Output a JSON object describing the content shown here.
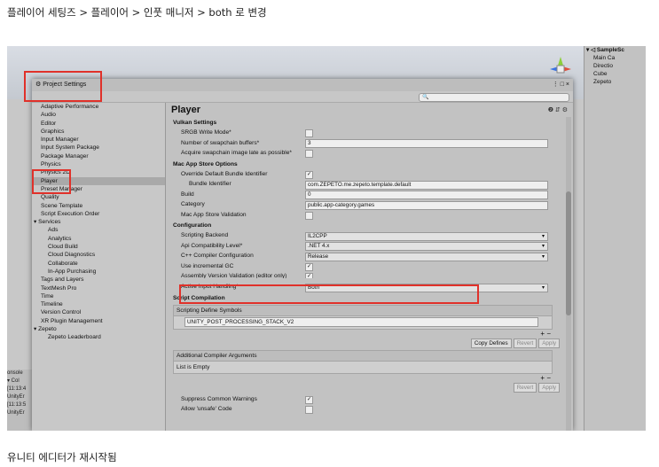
{
  "captions": {
    "top": "플레이어 세팅즈 > 플레이어 > 인풋 매니저 > both 로 변경",
    "bottom": "유니티 에디터가 재시작됨"
  },
  "hierarchy": {
    "items": [
      "▾ ◁ SampleSc",
      "Main Ca",
      "Directio",
      "Cube",
      "Zepeto"
    ]
  },
  "console": {
    "title": "onsole",
    "lines": [
      "▾ Col",
      "[11:13:4",
      "UnityEr",
      "[11:13:5",
      "UnityEr"
    ]
  },
  "window": {
    "title": "Project Settings",
    "controls": "⋮ □ ×",
    "search_placeholder": "🔍"
  },
  "sidebar": {
    "items": [
      {
        "label": "Adaptive Performance",
        "kind": "item"
      },
      {
        "label": "Audio",
        "kind": "item"
      },
      {
        "label": "Editor",
        "kind": "item"
      },
      {
        "label": "Graphics",
        "kind": "item"
      },
      {
        "label": "Input Manager",
        "kind": "item"
      },
      {
        "label": "Input System Package",
        "kind": "item"
      },
      {
        "label": "Package Manager",
        "kind": "item"
      },
      {
        "label": "Physics",
        "kind": "item"
      },
      {
        "label": "Physics 2D",
        "kind": "item"
      },
      {
        "label": "Player",
        "kind": "item",
        "selected": true
      },
      {
        "label": "Preset Manager",
        "kind": "item"
      },
      {
        "label": "Quality",
        "kind": "item"
      },
      {
        "label": "Scene Template",
        "kind": "item"
      },
      {
        "label": "Script Execution Order",
        "kind": "item"
      },
      {
        "label": "▾ Services",
        "kind": "group"
      },
      {
        "label": "Ads",
        "kind": "sub"
      },
      {
        "label": "Analytics",
        "kind": "sub"
      },
      {
        "label": "Cloud Build",
        "kind": "sub"
      },
      {
        "label": "Cloud Diagnostics",
        "kind": "sub"
      },
      {
        "label": "Collaborate",
        "kind": "sub"
      },
      {
        "label": "In-App Purchasing",
        "kind": "sub"
      },
      {
        "label": "Tags and Layers",
        "kind": "item"
      },
      {
        "label": "TextMesh Pro",
        "kind": "item"
      },
      {
        "label": "Time",
        "kind": "item"
      },
      {
        "label": "Timeline",
        "kind": "item"
      },
      {
        "label": "Version Control",
        "kind": "item"
      },
      {
        "label": "XR Plugin Management",
        "kind": "item"
      },
      {
        "label": "▾ Zepeto",
        "kind": "group"
      },
      {
        "label": "Zepeto Leaderboard",
        "kind": "sub"
      }
    ]
  },
  "main": {
    "title": "Player",
    "header_icons": "❷ ⇵ ⚙",
    "vulkan": {
      "heading": "Vulkan Settings",
      "srgb_label": "SRGB Write Mode*",
      "swapchain_label": "Number of swapchain buffers*",
      "swapchain_value": "3",
      "acquire_label": "Acquire swapchain image late as possible*"
    },
    "mac": {
      "heading": "Mac App Store Options",
      "override_label": "Override Default Bundle Identifier",
      "override_checked": "✓",
      "bundle_label": "Bundle Identifier",
      "bundle_value": "com.ZEPETO.me.zepeto.template.default",
      "build_label": "Build",
      "build_value": "0",
      "category_label": "Category",
      "category_value": "public.app-category.games",
      "validation_label": "Mac App Store Validation"
    },
    "config": {
      "heading": "Configuration",
      "backend_label": "Scripting Backend",
      "backend_value": "IL2CPP",
      "api_label": "Api Compatibility Level*",
      "api_value": ".NET 4.x",
      "cpp_label": "C++ Compiler Configuration",
      "cpp_value": "Release",
      "incgc_label": "Use incremental GC",
      "incgc_checked": "✓",
      "assembly_label": "Assembly Version Validation (editor only)",
      "assembly_checked": "✓",
      "input_label": "Active Input Handling*",
      "input_value": "Both"
    },
    "script": {
      "heading": "Script Compilation",
      "symbols_header": "Scripting Define Symbols",
      "symbols_value": "UNITY_POST_PROCESSING_STACK_V2",
      "plus_minus": "+ −",
      "copy_defines": "Copy Defines",
      "revert": "Revert",
      "apply": "Apply",
      "compiler_header": "Additional Compiler Arguments",
      "list_empty": "List is Empty",
      "suppress_label": "Suppress Common Warnings",
      "suppress_checked": "✓",
      "unsafe_label": "Allow 'unsafe' Code"
    }
  },
  "colors": {
    "highlight": "#e0312a"
  }
}
